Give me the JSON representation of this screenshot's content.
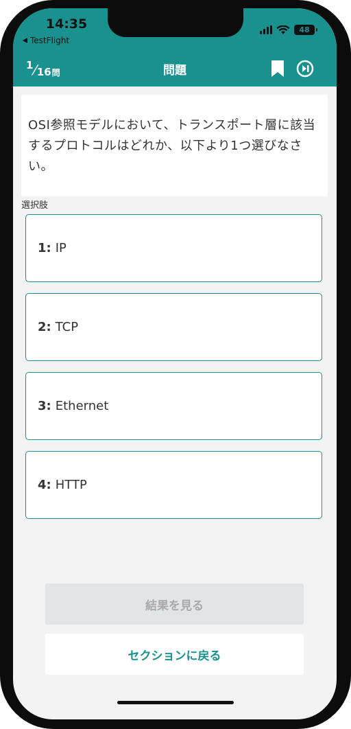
{
  "status_bar": {
    "time": "14:35",
    "back_app": "TestFlight",
    "battery": "48"
  },
  "nav": {
    "current": "1",
    "total": "16",
    "unit": "問",
    "title": "問題",
    "icons": [
      "bookmark-icon",
      "skip-forward-icon"
    ]
  },
  "question": {
    "text": "OSI参照モデルにおいて、トランスポート層に該当するプロトコルはどれか、以下より1つ選びなさい。"
  },
  "choices_label": "選択肢",
  "choices": [
    {
      "number": "1:",
      "label": "IP"
    },
    {
      "number": "2:",
      "label": "TCP"
    },
    {
      "number": "3:",
      "label": "Ethernet"
    },
    {
      "number": "4:",
      "label": "HTTP"
    }
  ],
  "buttons": {
    "result": "結果を見る",
    "back_to_section": "セクションに戻る"
  },
  "colors": {
    "accent": "#18918f",
    "background": "#f3f3f3",
    "disabled_button": "#e3e4e6"
  }
}
